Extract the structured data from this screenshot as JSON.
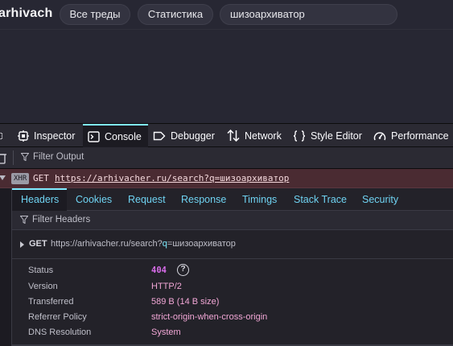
{
  "site": {
    "logo": "arhivach",
    "nav": {
      "all_threads": "Все треды",
      "statistics": "Статистика"
    },
    "search_value": "шизоархиватор"
  },
  "devtools": {
    "tabs": {
      "inspector": "Inspector",
      "console": "Console",
      "debugger": "Debugger",
      "network": "Network",
      "style_editor": "Style Editor",
      "performance": "Performance"
    },
    "active_tab": "console",
    "filter_output_placeholder": "Filter Output",
    "log_entry": {
      "badge": "XHR",
      "method": "GET",
      "url": "https://arhivacher.ru/search?q=шизоархиватор"
    },
    "detail_tabs": {
      "headers": "Headers",
      "cookies": "Cookies",
      "request": "Request",
      "response": "Response",
      "timings": "Timings",
      "stack_trace": "Stack Trace",
      "security": "Security"
    },
    "filter_headers_placeholder": "Filter Headers",
    "request_summary": {
      "method": "GET",
      "url_base": "https://arhivacher.ru/search?",
      "url_query_key": "q",
      "url_query_rest": "=шизоархиватор"
    },
    "details": {
      "status_label": "Status",
      "status_value": "404",
      "version_label": "Version",
      "version_value": "HTTP/2",
      "transferred_label": "Transferred",
      "transferred_value": "589 B (14 B size)",
      "referrer_label": "Referrer Policy",
      "referrer_value": "strict-origin-when-cross-origin",
      "dns_label": "DNS Resolution",
      "dns_value": "System"
    }
  },
  "colors": {
    "accent": "#80ebff",
    "error_row": "#4a2b32",
    "value_pink": "#f2a7d6",
    "status_purple": "#d86dea"
  }
}
